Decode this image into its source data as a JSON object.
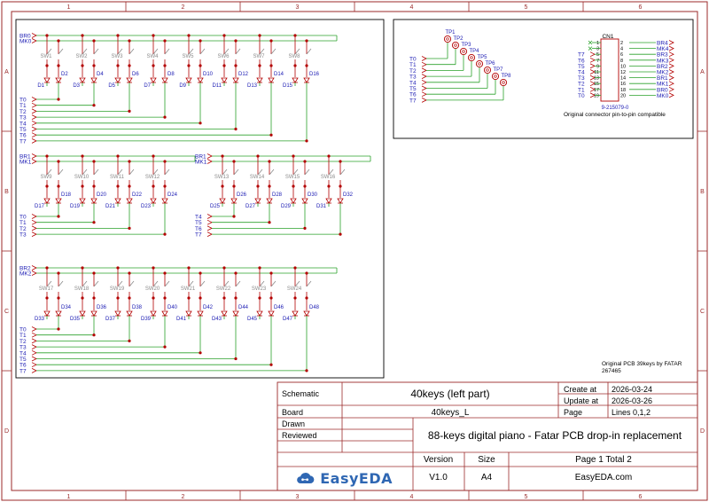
{
  "zones": {
    "columns": [
      "1",
      "2",
      "3",
      "4",
      "5",
      "6"
    ],
    "rows": [
      "A",
      "B",
      "C",
      "D"
    ]
  },
  "colors": {
    "frame": "#9b2a2a",
    "wire": "#2aa12a",
    "part": "#b30000",
    "junction": "#b30000",
    "label": "#1a1ab3",
    "sw": "#8a8a8a",
    "logo": "#2f67b3"
  },
  "blocks": {
    "block1": {
      "row_labels": [
        "BR0",
        "MK0"
      ],
      "col_labels": [
        "T0",
        "T1",
        "T2",
        "T3",
        "T4",
        "T5",
        "T6",
        "T7"
      ],
      "switches": [
        "SW1",
        "SW2",
        "SW3",
        "SW4",
        "SW5",
        "SW6",
        "SW7",
        "SW8"
      ],
      "diodes": [
        "D1",
        "D2",
        "D3",
        "D4",
        "D5",
        "D6",
        "D7",
        "D8",
        "D9",
        "D10",
        "D11",
        "D12",
        "D13",
        "D14",
        "D15",
        "D16"
      ]
    },
    "block2": {
      "row_labels": [
        "BR1",
        "MK1"
      ],
      "col_labels": [
        "T0",
        "T1",
        "T2",
        "T3"
      ],
      "switches": [
        "SW9",
        "SW10",
        "SW11",
        "SW12"
      ],
      "diodes": [
        "D17",
        "D18",
        "D19",
        "D20",
        "D21",
        "D22",
        "D23",
        "D24"
      ]
    },
    "block3": {
      "row_labels": [
        "BR1",
        "MK1"
      ],
      "col_labels": [
        "T4",
        "T5",
        "T6",
        "T7"
      ],
      "switches": [
        "SW13",
        "SW14",
        "SW15",
        "SW16"
      ],
      "diodes": [
        "D25",
        "D26",
        "D27",
        "D28",
        "D29",
        "D30",
        "D31",
        "D32"
      ]
    },
    "block4": {
      "row_labels": [
        "BR2",
        "MK2"
      ],
      "col_labels": [
        "T0",
        "T1",
        "T2",
        "T3",
        "T4",
        "T5",
        "T6",
        "T7"
      ],
      "switches": [
        "SW17",
        "SW18",
        "SW19",
        "SW20",
        "SW21",
        "SW22",
        "SW23",
        "SW24"
      ],
      "diodes": [
        "D33",
        "D34",
        "D35",
        "D36",
        "D37",
        "D38",
        "D39",
        "D40",
        "D41",
        "D42",
        "D43",
        "D44",
        "D45",
        "D46",
        "D47",
        "D48"
      ]
    }
  },
  "testpoints": {
    "col_labels": [
      "T0",
      "T1",
      "T2",
      "T3",
      "T4",
      "T5",
      "T6",
      "T7"
    ],
    "points": [
      "TP1",
      "TP2",
      "TP3",
      "TP4",
      "TP5",
      "TP6",
      "TP7",
      "TP8"
    ]
  },
  "connector": {
    "ref": "CN1",
    "part": "9-215079-0",
    "note": "Original connector pin-to-pin compatible",
    "left_nets": [
      "T7",
      "T6",
      "T5",
      "T4",
      "T3",
      "T2",
      "T1",
      "T0"
    ],
    "right_nets": [
      "BR4",
      "MK4",
      "BR3",
      "MK3",
      "BR2",
      "MK2",
      "BR1",
      "MK1",
      "BR0",
      "MK0"
    ],
    "odd_pins": [
      "1",
      "3",
      "5",
      "7",
      "9",
      "11",
      "13",
      "15",
      "17",
      "19"
    ],
    "even_pins": [
      "2",
      "4",
      "6",
      "8",
      "10",
      "12",
      "14",
      "16",
      "18",
      "20"
    ]
  },
  "original_note": {
    "line1": "Original PCB 39keys by FATAR",
    "line2": "267465"
  },
  "title_block": {
    "schematic_label": "Schematic",
    "sheet_name": "40keys (left part)",
    "create_label": "Create at",
    "create_date": "2026-03-24",
    "update_label": "Update at",
    "update_date": "2026-03-26",
    "board_label": "Board",
    "board_name": "40keys_L",
    "page_label": "Page",
    "page_value": "Lines 0,1,2",
    "drawn_label": "Drawn",
    "reviewed_label": "Reviewed",
    "project_title": "88-keys digital piano - Fatar PCB drop-in replacement",
    "version_label": "Version",
    "version_value": "V1.0",
    "size_label": "Size",
    "size_value": "A4",
    "page_count": "Page  1  Total  2",
    "site": "EasyEDA.com",
    "logo_text": "EasyEDA"
  }
}
